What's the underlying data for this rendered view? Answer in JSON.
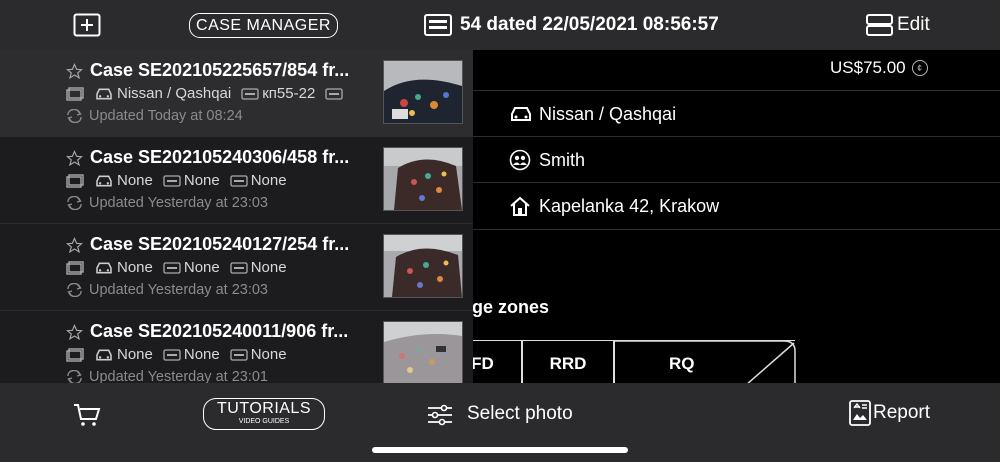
{
  "app": {
    "case_manager_label": "CASE MANAGER"
  },
  "detail": {
    "title": "54 dated 22/05/2021 08:56:57",
    "edit_label": "Edit",
    "price": "US$75.00",
    "price_icon": "coin-icon",
    "rows": [
      {
        "icon": "car-icon",
        "text": "Nissan / Qashqai"
      },
      {
        "icon": "people-icon",
        "text": "Smith"
      },
      {
        "icon": "home-icon",
        "text": "Kapelanka 42, Krakow"
      }
    ],
    "zones_label": "age zones",
    "zones": [
      "FD",
      "RRD",
      "RQ"
    ]
  },
  "cases": [
    {
      "title": "Case SE202105225657/854 fr...",
      "vehicle": "Nissan / Qashqai",
      "plate": "кп55-22",
      "vin": "",
      "updated": "Updated Today at 08:24",
      "selected": true
    },
    {
      "title": "Case SE202105240306/458 fr...",
      "vehicle": "None",
      "plate": "None",
      "vin": "None",
      "updated": "Updated Yesterday at 23:03",
      "selected": false
    },
    {
      "title": "Case SE202105240127/254 fr...",
      "vehicle": "None",
      "plate": "None",
      "vin": "None",
      "updated": "Updated Yesterday at 23:03",
      "selected": false
    },
    {
      "title": "Case SE202105240011/906 fr...",
      "vehicle": "None",
      "plate": "None",
      "vin": "None",
      "updated": "Updated Yesterday at 23:01",
      "selected": false
    }
  ],
  "bottom": {
    "tutorials_label": "TUTORIALS",
    "tutorials_sub": "VIDEO GUIDES",
    "select_photo_label": "Select photo",
    "report_label": "Report"
  },
  "colors": {
    "bar": "#2b2b2d",
    "sidebar": "#1c1c1e",
    "selected_row": "#2d2d2f"
  }
}
